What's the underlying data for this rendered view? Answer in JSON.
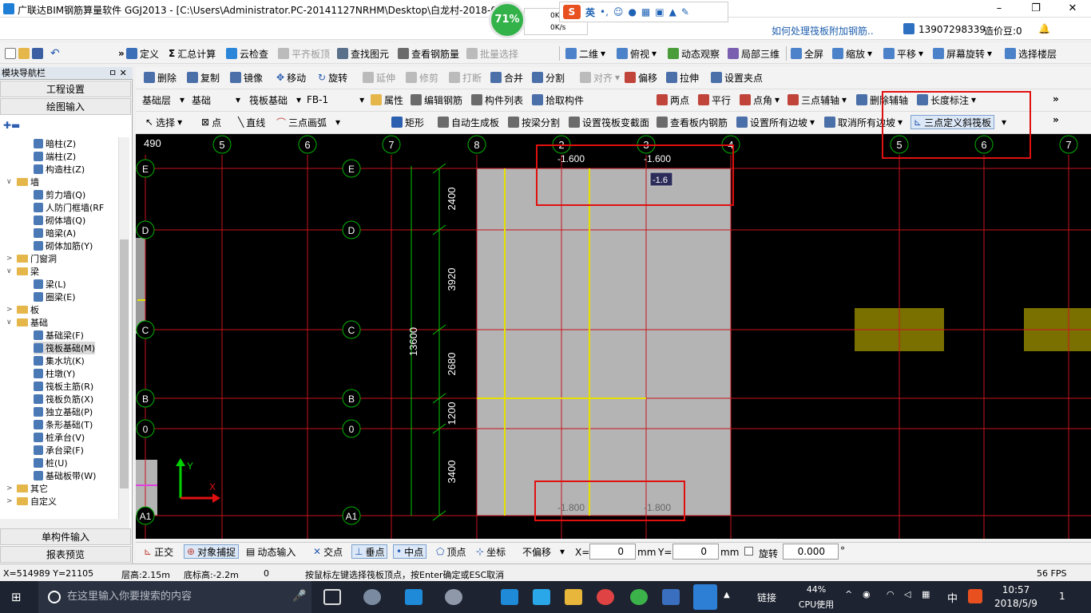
{
  "window": {
    "title": "广联达BIM钢筋算量软件 GGJ2013 - [C:\\Users\\Administrator.PC-20141127NRHM\\Desktop\\白龙村-2018-0",
    "min": "–",
    "max": "❐",
    "close": "✕"
  },
  "overlay": {
    "percent": "71%",
    "up": "0K/s",
    "down": "0K/s",
    "ime": "英"
  },
  "help_link": "如何处理筏板附加钢筋..",
  "user": {
    "phone": "13907298339",
    "credit": "造价豆:0"
  },
  "toolbar1": [
    "定义",
    "汇总计算",
    "云检查",
    "平齐板顶",
    "查找图元",
    "查看钢筋量",
    "批量选择",
    "二维",
    "俯视",
    "动态观察",
    "局部三维",
    "全屏",
    "缩放",
    "平移",
    "屏幕旋转",
    "选择楼层"
  ],
  "toolbar2": [
    "删除",
    "复制",
    "镜像",
    "移动",
    "旋转",
    "延伸",
    "修剪",
    "打断",
    "合并",
    "分割",
    "对齐",
    "偏移",
    "拉伸",
    "设置夹点"
  ],
  "toolbar3": {
    "floor": "基础层",
    "category": "基础",
    "type": "筏板基础",
    "item": "FB-1",
    "buttons": [
      "属性",
      "编辑钢筋",
      "构件列表",
      "拾取构件"
    ],
    "right": [
      "两点",
      "平行",
      "点角",
      "三点辅轴",
      "删除辅轴",
      "长度标注"
    ]
  },
  "toolbar4": [
    "选择",
    "点",
    "直线",
    "三点画弧",
    "矩形",
    "自动生成板",
    "按梁分割",
    "设置筏板变截面",
    "查看板内钢筋",
    "设置所有边坡",
    "取消所有边坡",
    "三点定义斜筏板"
  ],
  "nav": {
    "header": "模块导航栏",
    "pin": "ㅁ ✕",
    "project": "工程设置",
    "drawing": "绘图输入",
    "single": "单构件输入",
    "report": "报表预览",
    "tree": [
      {
        "t": "暗柱(Z)",
        "lvl": 2,
        "k": "i"
      },
      {
        "t": "端柱(Z)",
        "lvl": 2,
        "k": "i"
      },
      {
        "t": "构造柱(Z)",
        "lvl": 2,
        "k": "i"
      },
      {
        "t": "墙",
        "lvl": 1,
        "k": "f",
        "o": "∨"
      },
      {
        "t": "剪力墙(Q)",
        "lvl": 2,
        "k": "i"
      },
      {
        "t": "人防门框墙(RF",
        "lvl": 2,
        "k": "i"
      },
      {
        "t": "砌体墙(Q)",
        "lvl": 2,
        "k": "i"
      },
      {
        "t": "暗梁(A)",
        "lvl": 2,
        "k": "i"
      },
      {
        "t": "砌体加筋(Y)",
        "lvl": 2,
        "k": "i"
      },
      {
        "t": "门窗洞",
        "lvl": 1,
        "k": "f",
        "o": ">"
      },
      {
        "t": "梁",
        "lvl": 1,
        "k": "f",
        "o": "∨"
      },
      {
        "t": "梁(L)",
        "lvl": 2,
        "k": "i"
      },
      {
        "t": "圈梁(E)",
        "lvl": 2,
        "k": "i"
      },
      {
        "t": "板",
        "lvl": 1,
        "k": "f",
        "o": ">"
      },
      {
        "t": "基础",
        "lvl": 1,
        "k": "f",
        "o": "∨"
      },
      {
        "t": "基础梁(F)",
        "lvl": 2,
        "k": "i"
      },
      {
        "t": "筏板基础(M)",
        "lvl": 2,
        "k": "i",
        "sel": true
      },
      {
        "t": "集水坑(K)",
        "lvl": 2,
        "k": "i"
      },
      {
        "t": "柱墩(Y)",
        "lvl": 2,
        "k": "i"
      },
      {
        "t": "筏板主筋(R)",
        "lvl": 2,
        "k": "i"
      },
      {
        "t": "筏板负筋(X)",
        "lvl": 2,
        "k": "i"
      },
      {
        "t": "独立基础(P)",
        "lvl": 2,
        "k": "i"
      },
      {
        "t": "条形基础(T)",
        "lvl": 2,
        "k": "i"
      },
      {
        "t": "桩承台(V)",
        "lvl": 2,
        "k": "i"
      },
      {
        "t": "承台梁(F)",
        "lvl": 2,
        "k": "i"
      },
      {
        "t": "桩(U)",
        "lvl": 2,
        "k": "i"
      },
      {
        "t": "基础板带(W)",
        "lvl": 2,
        "k": "i"
      },
      {
        "t": "其它",
        "lvl": 1,
        "k": "f",
        "o": ">"
      },
      {
        "t": "自定义",
        "lvl": 1,
        "k": "f",
        "o": ">"
      }
    ]
  },
  "cad": {
    "corner": "490",
    "cols": [
      {
        "label": "5"
      },
      {
        "label": "6"
      },
      {
        "label": "7"
      },
      {
        "label": "8"
      },
      {
        "label": "2"
      },
      {
        "label": "3"
      },
      {
        "label": "4"
      },
      {
        "label": "5"
      },
      {
        "label": "6"
      },
      {
        "label": "7"
      }
    ],
    "rows": [
      {
        "label": "E"
      },
      {
        "label": "D"
      },
      {
        "label": "C"
      },
      {
        "label": "B"
      },
      {
        "label": "0"
      },
      {
        "label": "A1"
      }
    ],
    "dims": [
      "2400",
      "3920",
      "2680",
      "1200",
      "3400"
    ],
    "total": "13600",
    "elev": [
      "-1.600",
      "-1.600",
      "-1.800",
      "-1.800"
    ],
    "tooltip": "-1.6",
    "axis_y": "Y",
    "axis_x": "X"
  },
  "snapbar": {
    "items": [
      "正交",
      "对象捕捉",
      "动态输入",
      "交点",
      "垂点",
      "中点",
      "顶点",
      "坐标"
    ],
    "offset": "不偏移",
    "x_label": "X=",
    "x": "0",
    "y_label": "Y=",
    "y": "0",
    "unit": "mm",
    "rotate": "旋转",
    "rot": "0.000",
    "deg": "°"
  },
  "status": {
    "coord": "X=514989 Y=21105",
    "floor_h": "层高:2.15m",
    "bottom": "底标高:-2.2m",
    "zero": "0",
    "hint": "按鼠标左键选择筏板顶点，按Enter确定或ESC取消",
    "fps": "56 FPS"
  },
  "taskbar": {
    "search": "在这里输入你要搜索的内容",
    "link": "链接",
    "cpu_pct": "44%",
    "cpu": "CPU使用",
    "lang": "中",
    "time": "10:57",
    "date": "2018/5/9",
    "notif": "1"
  }
}
